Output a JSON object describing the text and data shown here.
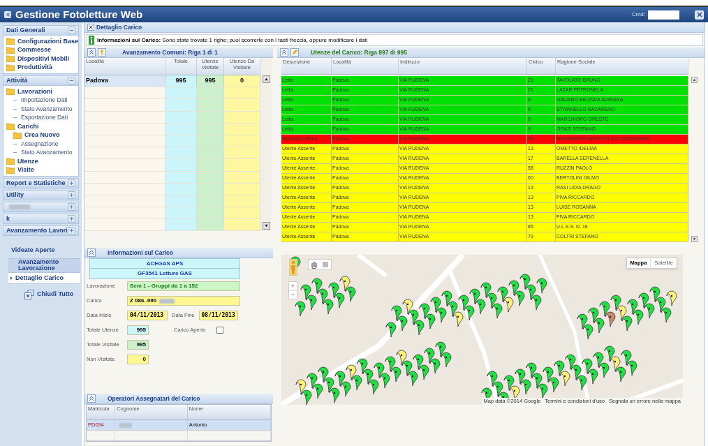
{
  "window": {
    "title": "Gestione Fotoletture Web",
    "cmd_label": "Cmd:"
  },
  "sidebar": {
    "sections": [
      {
        "title": "Dati Generali",
        "expanded": true,
        "items": [
          {
            "label": "Configurazioni Base",
            "kind": "folder"
          },
          {
            "label": "Commesse",
            "kind": "folder"
          },
          {
            "label": "Dispositivi Mobili",
            "kind": "folder"
          },
          {
            "label": "Produttività",
            "kind": "folder"
          }
        ]
      },
      {
        "title": "Attività",
        "expanded": true,
        "items": [
          {
            "label": "Lavorazioni",
            "kind": "folder",
            "children": [
              {
                "label": "Importazione Dati",
                "kind": "leaf"
              },
              {
                "label": "Stato Avanzamento",
                "kind": "leaf"
              },
              {
                "label": "Esportazione Dati",
                "kind": "leaf"
              }
            ]
          },
          {
            "label": "Carichi",
            "kind": "folder",
            "children": [
              {
                "label": "Crea Nuovo",
                "kind": "folder"
              },
              {
                "label": "Assegnazione",
                "kind": "leaf"
              },
              {
                "label": "Stato Avanzamento",
                "kind": "leaf"
              }
            ]
          },
          {
            "label": "Utenze",
            "kind": "folder"
          },
          {
            "label": "Visite",
            "kind": "folder"
          }
        ]
      },
      {
        "title": "Report e Statistiche",
        "expanded": false
      },
      {
        "title": "Utility",
        "expanded": false
      },
      {
        "expanded": false
      },
      {
        "title": "k",
        "expanded": false
      },
      {
        "title": "Avanzamento Lavori",
        "expanded": false
      }
    ],
    "open_views_title": "Videate Aperte",
    "open_views": [
      {
        "label": "Avanzamento Lavorazione",
        "selected": false
      },
      {
        "label": "Dettaglio Carico",
        "selected": true
      }
    ],
    "close_all": "Chiudi Tutto"
  },
  "tab": {
    "title": "Dettaglio Carico"
  },
  "info_bar": "**Informazioni sul Carico:** Sono state trovate 1 righe; puoi scorrerle con i tasti freccia, oppure modificare i dati",
  "comuni": {
    "title": "Avanzamento Comuni: Riga 1 di 1",
    "columns": [
      "Località",
      "Totale",
      "Utenze Visitate",
      "Utenze Da Visitare"
    ],
    "rows": [
      [
        "Padova",
        "995",
        "995",
        "0"
      ]
    ]
  },
  "utenze": {
    "title": "Utenze del Carico: Riga 897 di 995",
    "columns": [
      "Descrizione",
      "Località",
      "Indirizzo",
      "Civico",
      "Ragione Sociale"
    ],
    "rows": [
      {
        "color": "#00e000",
        "cells": [
          "Letta",
          "Padova",
          "VIA RUDENA",
          "21",
          "TAVOLATO BRUNO"
        ]
      },
      {
        "color": "#00e000",
        "cells": [
          "Letta",
          "Padova",
          "VIA RUDENA",
          "21",
          "LAZAR PETRONELA"
        ]
      },
      {
        "color": "#00e000",
        "cells": [
          "Letta",
          "Padova",
          "VIA RUDENA",
          "9",
          "GALIANO BELINDA ADRIANA"
        ]
      },
      {
        "color": "#00e000",
        "cells": [
          "Letta",
          "Padova",
          "VIA RUDENA",
          "9",
          "STIVANELLO  NAZARENO"
        ]
      },
      {
        "color": "#00e000",
        "cells": [
          "Letta",
          "Padova",
          "VIA RUDENA",
          "9",
          "MARCHIORO ORESTE"
        ]
      },
      {
        "color": "#00e000",
        "cells": [
          "Letta",
          "Padova",
          "VIA RUDENA",
          "9",
          "ORAZI STEFANO"
        ]
      },
      {
        "color": "#ff0000",
        "cells": [
          "Mancata Lettura",
          "Padova",
          "VIA RUDENA",
          "59",
          "MOVIMENTO APOSTOLICO DIOCESANO"
        ]
      },
      {
        "color": "#ffff00",
        "cells": [
          "Utente Assente",
          "Padova",
          "VIA RUDENA",
          "13",
          "OMETTO IDELMA"
        ]
      },
      {
        "color": "#ffff00",
        "cells": [
          "Utente Assente",
          "Padova",
          "VIA RUDENA",
          "17",
          "BARELLA SERENELLA"
        ]
      },
      {
        "color": "#ffff00",
        "cells": [
          "Utente Assente",
          "Padova",
          "VIA RUDENA",
          "58",
          "RUZZIN PAOLO"
        ]
      },
      {
        "color": "#ffff00",
        "cells": [
          "Utente Assente",
          "Padova",
          "VIA RUDENA",
          "60",
          "BERTOLINI GILMO"
        ]
      },
      {
        "color": "#ffff00",
        "cells": [
          "Utente Assente",
          "Padova",
          "VIA RUDENA",
          "13",
          "RASI LIDIA DRAGO"
        ]
      },
      {
        "color": "#ffff00",
        "cells": [
          "Utente Assente",
          "Padova",
          "VIA RUDENA",
          "13",
          "PIVA RICCARDO"
        ]
      },
      {
        "color": "#ffff00",
        "cells": [
          "Utente Assente",
          "Padova",
          "VIA RUDENA",
          "13",
          "LUISE ROSANNA"
        ]
      },
      {
        "color": "#ffff00",
        "cells": [
          "Utente Assente",
          "Padova",
          "VIA RUDENA",
          "13",
          "PIVA RICCARDO"
        ]
      },
      {
        "color": "#ffff00",
        "cells": [
          "Utente Assente",
          "Padova",
          "VIA RUDENA",
          "85",
          "U.L.S.S. N. 16"
        ]
      },
      {
        "color": "#ffff00",
        "cells": [
          "Utente Assente",
          "Padova",
          "VIA RUDENA",
          "79",
          "COLTRI STEFANO"
        ]
      }
    ]
  },
  "carico": {
    "title": "Informazioni sul Carico",
    "company": "ACEGAS APS",
    "service": "GF3541 Letture GAS",
    "lavorazione_label": "Lavorazione",
    "lavorazione": "Sem 1 - Gruppi da 1 a 152",
    "carico_label": "Carico",
    "carico": "Z 086..090",
    "data_inizio_label": "Data Inizio",
    "data_inizio": "04/11/2013",
    "data_fine_label": "Data Fine",
    "data_fine": "08/11/2013",
    "totale_utenze_label": "Totale Utenze",
    "totale_utenze": "995",
    "carico_aperto_label": "Carico Aperto",
    "carico_aperto": false,
    "totale_visitate_label": "Totale Visitate",
    "totale_visitate": "995",
    "non_visitate_label": "Non Visitate",
    "non_visitate": "0"
  },
  "operatori": {
    "title": "Operatori Assegnatari del Carico",
    "columns": [
      "Matricola",
      "Cognome",
      "Nome"
    ],
    "rows": [
      {
        "matricola": "PD034",
        "nome": "Antonio"
      }
    ]
  },
  "map": {
    "kind": "picture",
    "types": [
      {
        "label": "Mappa",
        "selected": true
      },
      {
        "label": "Satellite",
        "selected": false
      }
    ],
    "zoom_in": "+",
    "zoom_out": "−",
    "attribution": [
      "Map data ©2014 Google",
      "Termini e condizioni d'uso",
      "Segnala un errore nella mappa"
    ]
  }
}
